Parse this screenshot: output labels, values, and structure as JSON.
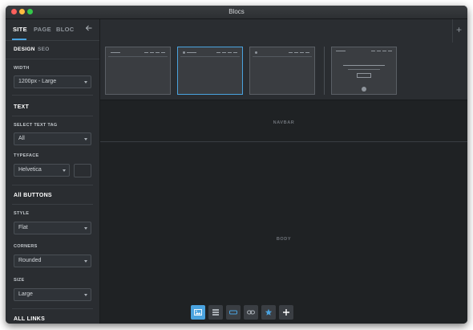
{
  "window": {
    "title": "Blocs"
  },
  "sidebar": {
    "tabs": [
      {
        "label": "SITE"
      },
      {
        "label": "PAGE"
      },
      {
        "label": "BLOC"
      }
    ],
    "subtabs": [
      {
        "label": "DESIGN"
      },
      {
        "label": "SEO"
      }
    ],
    "width": {
      "label": "WIDTH",
      "value": "1200px - Large"
    },
    "text_section": {
      "title": "TEXT"
    },
    "select_text_tag": {
      "label": "SELECT TEXT TAG",
      "value": "All"
    },
    "typeface": {
      "label": "TYPEFACE",
      "value": "Helvetica"
    },
    "buttons_section": {
      "title": "All BUTTONS"
    },
    "style": {
      "label": "STYLE",
      "value": "Flat"
    },
    "corners": {
      "label": "CORNERS",
      "value": "Rounded"
    },
    "size": {
      "label": "SIZE",
      "value": "Large"
    },
    "links_section": {
      "title": "ALL LINKS"
    }
  },
  "canvas": {
    "navbar_label": "NAVBAR",
    "body_label": "BODY",
    "selected_thumbnail_index": 1
  },
  "toolbar": {
    "buttons": [
      {
        "icon": "image-icon",
        "active": true
      },
      {
        "icon": "layers-icon",
        "active": false
      },
      {
        "icon": "button-icon",
        "active": false
      },
      {
        "icon": "link-icon",
        "active": false
      },
      {
        "icon": "star-icon",
        "active": false
      },
      {
        "icon": "plus-icon",
        "active": false
      }
    ]
  },
  "colors": {
    "accent": "#4aa3df",
    "sidebar_bg": "#2a2d31",
    "canvas_bg": "#1f2224"
  }
}
